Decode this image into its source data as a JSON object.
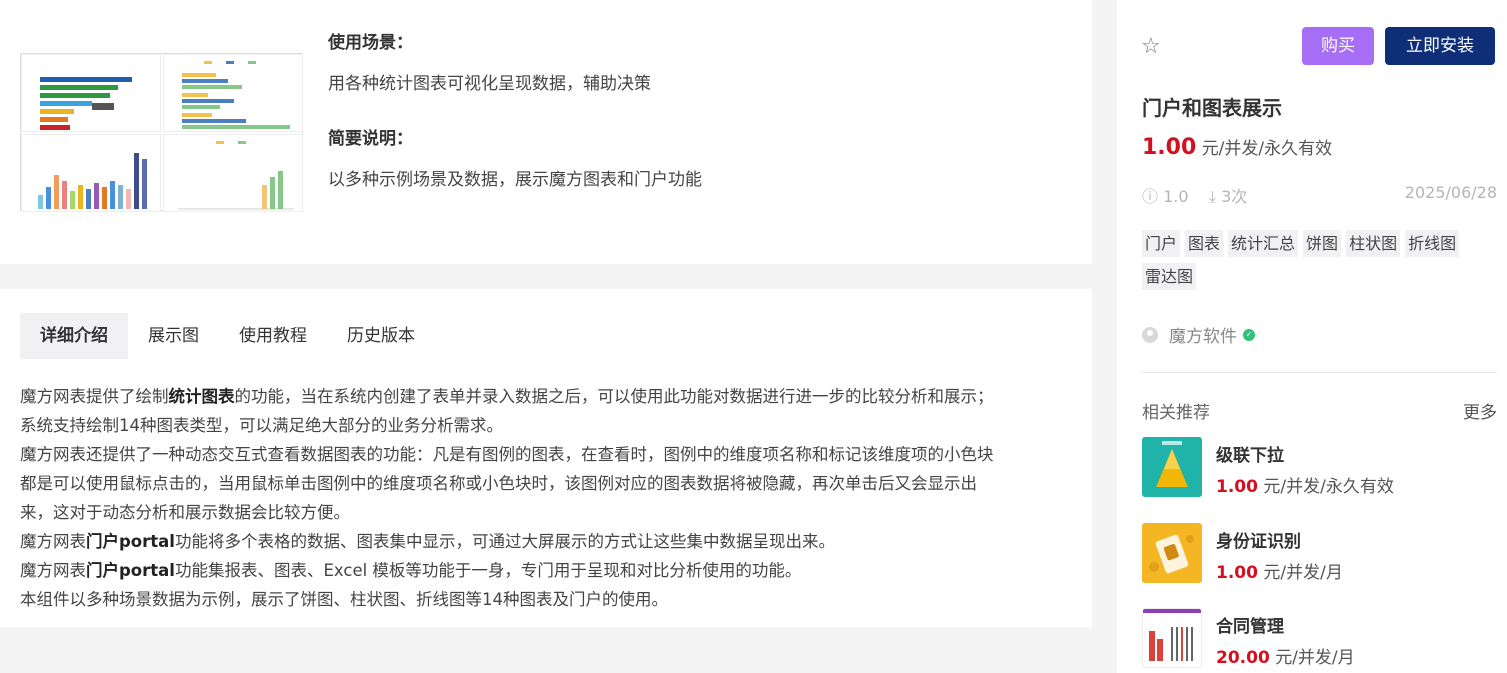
{
  "intro": {
    "scene_label": "使用场景：",
    "scene_text": "用各种统计图表可视化呈现数据，辅助决策",
    "summary_label": "简要说明：",
    "summary_text": "以多种示例场景及数据，展示魔方图表和门户功能"
  },
  "tabs": [
    {
      "label": "详细介绍"
    },
    {
      "label": "展示图"
    },
    {
      "label": "使用教程"
    },
    {
      "label": "历史版本"
    }
  ],
  "description": {
    "l1a": "魔方网表提供了绘制",
    "l1b": "统计图表",
    "l1c": "的功能，当在系统内创建了表单并录入数据之后，可以使用此功能对数据进行进一步的比较分析和展示；",
    "l2": "系统支持绘制14种图表类型，可以满足绝大部分的业务分析需求。",
    "l3": "魔方网表还提供了一种动态交互式查看数据图表的功能：凡是有图例的图表，在查看时，图例中的维度项名称和标记该维度项的小色块",
    "l4": "都是可以使用鼠标点击的，当用鼠标单击图例中的维度项名称或小色块时，该图例对应的图表数据将被隐藏，再次单击后又会显示出",
    "l5": "来，这对于动态分析和展示数据会比较方便。",
    "l6a": "魔方网表",
    "l6b": "门户portal",
    "l6c": "功能将多个表格的数据、图表集中显示，可通过大屏展示的方式让这些集中数据呈现出来。",
    "l7a": "魔方网表",
    "l7b": "门户portal",
    "l7c": "功能集报表、图表、Excel 模板等功能于一身，专门用于呈现和对比分析使用的功能。",
    "l8": "本组件以多种场景数据为示例，展示了饼图、柱状图、折线图等14种图表及门户的使用。"
  },
  "product": {
    "buy_label": "购买",
    "install_label": "立即安装",
    "title": "门户和图表展示",
    "price": "1.00",
    "price_unit": "元/并发/永久有效",
    "version": "1.0",
    "downloads": "3次",
    "date": "2025/06/28",
    "tags": [
      "门户",
      "图表",
      "统计汇总",
      "饼图",
      "柱状图",
      "折线图",
      "雷达图"
    ],
    "vendor": "魔方软件"
  },
  "recommend": {
    "heading": "相关推荐",
    "more": "更多",
    "items": [
      {
        "name": "级联下拉",
        "price": "1.00",
        "unit": "元/并发/永久有效"
      },
      {
        "name": "身份证识别",
        "price": "1.00",
        "unit": "元/并发/月"
      },
      {
        "name": "合同管理",
        "price": "20.00",
        "unit": "元/并发/月"
      }
    ]
  },
  "colors": {
    "buy": "#a66ef5",
    "install": "#0e2f78",
    "price": "#d4101f",
    "verified": "#2fc27a"
  }
}
